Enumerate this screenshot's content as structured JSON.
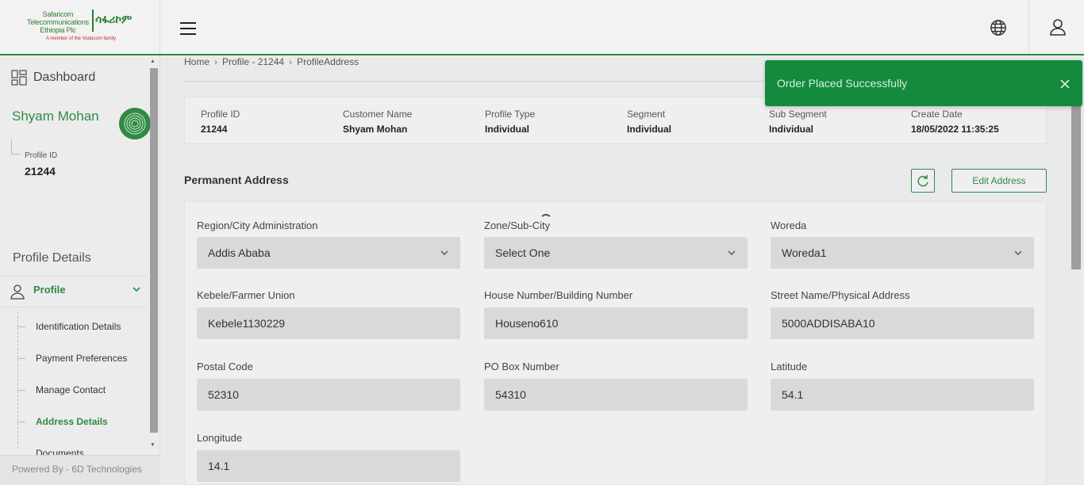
{
  "header": {
    "logo_line1": "Safaricom",
    "logo_line2": "Telecommunications",
    "logo_line3": "Ethiopia Plc",
    "logo_amharic": "ሳፋሪኮም",
    "logo_tagline": "A member of the Vodacom family"
  },
  "sidebar": {
    "dashboard_label": "Dashboard",
    "customer_name": "Shyam Mohan",
    "profile_id_label": "Profile ID",
    "profile_id_value": "21244",
    "section_title": "Profile Details",
    "profile_label": "Profile",
    "items": [
      {
        "label": "Identification Details",
        "active": false
      },
      {
        "label": "Payment Preferences",
        "active": false
      },
      {
        "label": "Manage Contact",
        "active": false
      },
      {
        "label": "Address Details",
        "active": true
      },
      {
        "label": "Documents",
        "active": false
      }
    ],
    "footer": "Powered By - 6D Technologies"
  },
  "breadcrumb": {
    "home": "Home",
    "profile": "Profile - 21244",
    "current": "ProfileAddress"
  },
  "info": {
    "profile_id_label": "Profile ID",
    "profile_id": "21244",
    "customer_name_label": "Customer Name",
    "customer_name": "Shyam Mohan",
    "profile_type_label": "Profile Type",
    "profile_type": "Individual",
    "segment_label": "Segment",
    "segment": "Individual",
    "sub_segment_label": "Sub Segment",
    "sub_segment": "Individual",
    "create_date_label": "Create Date",
    "create_date": "18/05/2022 11:35:25"
  },
  "address": {
    "title": "Permanent Address",
    "edit_button": "Edit Address",
    "region_label": "Region/City Administration",
    "region_value": "Addis Ababa",
    "zone_label": "Zone/Sub-City",
    "zone_value": "Select One",
    "woreda_label": "Woreda",
    "woreda_value": "Woreda1",
    "kebele_label": "Kebele/Farmer Union",
    "kebele_value": "Kebele1130229",
    "house_label": "House Number/Building Number",
    "house_value": "Houseno610",
    "street_label": "Street Name/Physical Address",
    "street_value": "5000ADDISABA10",
    "postal_label": "Postal Code",
    "postal_value": "52310",
    "pobox_label": "PO Box Number",
    "pobox_value": "54310",
    "latitude_label": "Latitude",
    "latitude_value": "54.1",
    "longitude_label": "Longitude",
    "longitude_value": "14.1"
  },
  "toast": {
    "message": "Order Placed Successfully"
  },
  "colors": {
    "brand_green": "#2f8a45",
    "toast_green": "#138a3d"
  },
  "icons": [
    "hamburger-icon",
    "globe-icon",
    "user-icon",
    "dashboard-icon",
    "fingerprint-icon",
    "person-icon",
    "chevron-down-icon",
    "refresh-icon",
    "close-icon"
  ]
}
